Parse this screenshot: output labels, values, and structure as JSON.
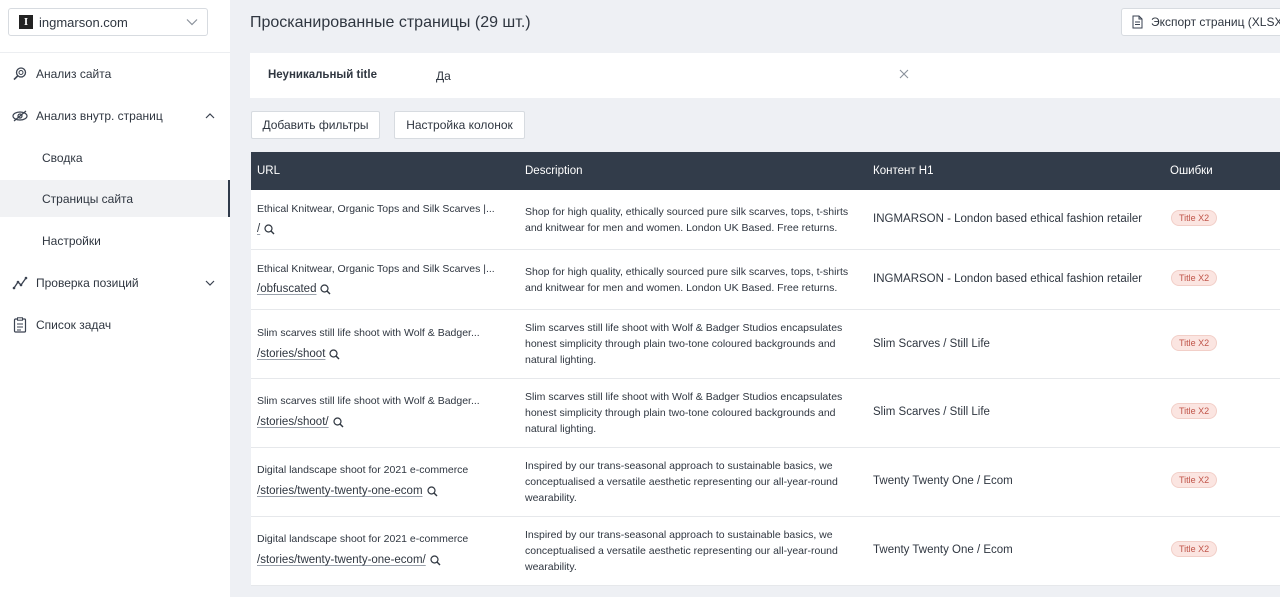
{
  "sidebar": {
    "site": {
      "logo": "I",
      "name": "ingmarson.com"
    },
    "items": [
      {
        "label": "Анализ сайта",
        "icon": "site-analysis-icon"
      },
      {
        "label": "Анализ внутр. страниц",
        "icon": "pages-analysis-icon",
        "expanded": true
      },
      {
        "label": "Сводка"
      },
      {
        "label": "Страницы сайта",
        "active": true
      },
      {
        "label": "Настройки"
      },
      {
        "label": "Проверка позиций",
        "icon": "positions-icon",
        "expanded": false
      },
      {
        "label": "Список задач",
        "icon": "tasks-icon"
      }
    ]
  },
  "header": {
    "title": "Просканированные страницы (29 шт.)",
    "export_label": "Экспорт страниц (XLSX)"
  },
  "filter": {
    "name": "Неуникальный title",
    "value": "Да"
  },
  "toolbar": {
    "add_filters": "Добавить фильтры",
    "columns_settings": "Настройка колонок"
  },
  "table": {
    "columns": [
      "URL",
      "Description",
      "Контент H1",
      "Ошибки"
    ],
    "rows": [
      {
        "title": "Ethical Knitwear, Organic Tops and Silk Scarves |...",
        "path": "/",
        "description": "Shop for high quality, ethically sourced pure silk scarves, tops, t-shirts and knitwear for men and women. London UK Based. Free returns.",
        "h1": "INGMARSON - London based ethical fashion retailer",
        "error": "Title X2"
      },
      {
        "title": "Ethical Knitwear, Organic Tops and Silk Scarves |...",
        "path": "/obfuscated",
        "description": "Shop for high quality, ethically sourced pure silk scarves, tops, t-shirts and knitwear for men and women. London UK Based. Free returns.",
        "h1": "INGMARSON - London based ethical fashion retailer",
        "error": "Title X2"
      },
      {
        "title": "Slim scarves still life shoot with Wolf & Badger...",
        "path": "/stories/shoot",
        "description": "Slim scarves still life shoot with Wolf & Badger Studios encapsulates honest simplicity through plain two-tone coloured backgrounds and natural lighting.",
        "h1": "Slim Scarves / Still Life",
        "error": "Title X2"
      },
      {
        "title": "Slim scarves still life shoot with Wolf & Badger...",
        "path": "/stories/shoot/",
        "description": "Slim scarves still life shoot with Wolf & Badger Studios encapsulates honest simplicity through plain two-tone coloured backgrounds and natural lighting.",
        "h1": "Slim Scarves / Still Life",
        "error": "Title X2"
      },
      {
        "title": "Digital landscape shoot for 2021 e-commerce",
        "path": "/stories/twenty-twenty-one-ecom",
        "description": "Inspired by our trans-seasonal approach to sustainable basics, we conceptualised a versatile aesthetic representing our all-year-round wearability.",
        "h1": "Twenty Twenty One / Ecom",
        "error": "Title X2"
      },
      {
        "title": "Digital landscape shoot for 2021 e-commerce",
        "path": "/stories/twenty-twenty-one-ecom/",
        "description": "Inspired by our trans-seasonal approach to sustainable basics, we conceptualised a versatile aesthetic representing our all-year-round wearability.",
        "h1": "Twenty Twenty One / Ecom",
        "error": "Title X2"
      }
    ]
  }
}
